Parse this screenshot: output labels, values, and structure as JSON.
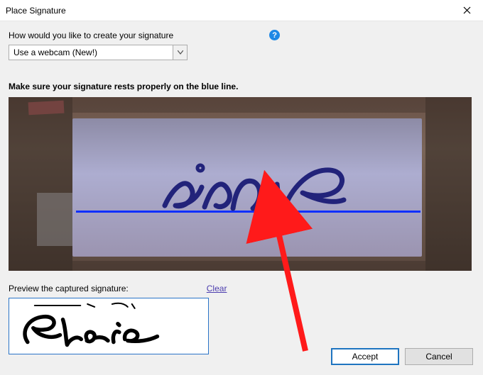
{
  "window": {
    "title": "Place Signature"
  },
  "question": {
    "label": "How would you like to create your signature"
  },
  "method_select": {
    "selected": "Use a webcam (New!)"
  },
  "instruction": "Make sure your signature rests properly on the blue line.",
  "preview": {
    "label": "Preview the captured signature:",
    "clear": "Clear"
  },
  "buttons": {
    "accept": "Accept",
    "cancel": "Cancel"
  }
}
